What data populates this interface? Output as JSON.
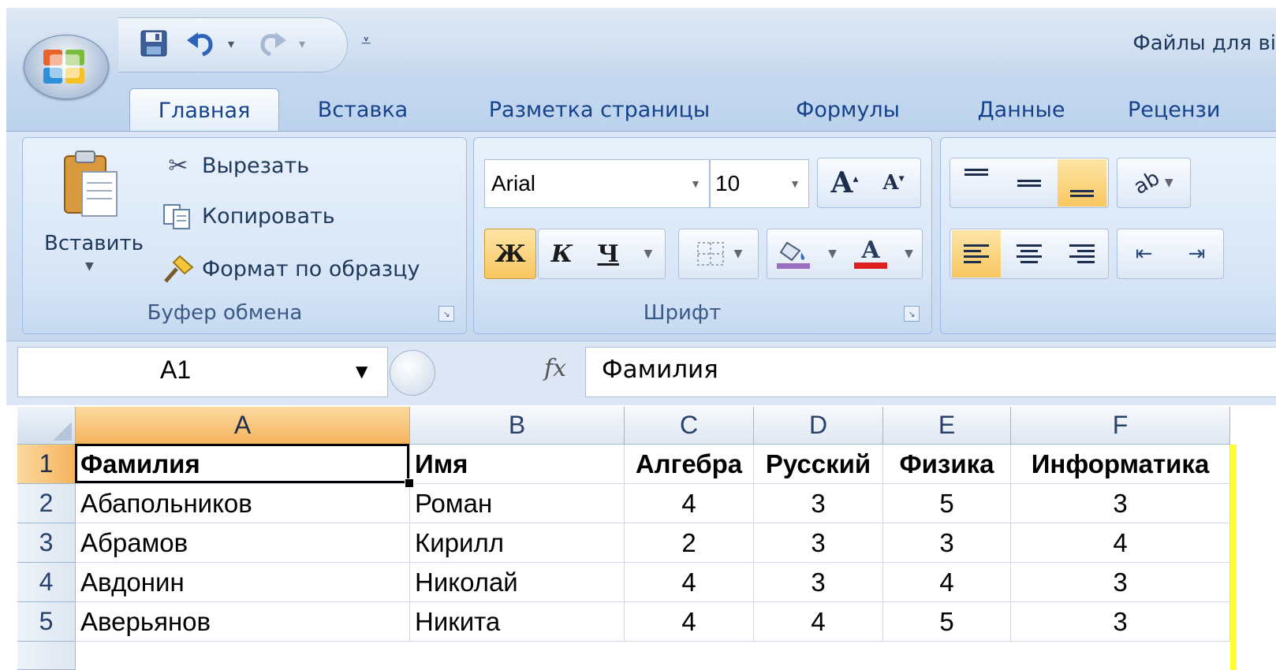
{
  "window": {
    "title": "Файлы для ві"
  },
  "quick_access": {
    "save_icon": "save-icon",
    "undo_icon": "undo-icon",
    "redo_icon": "redo-icon",
    "customize_icon": "customize-qat-icon"
  },
  "tabs": [
    {
      "label": "Главная",
      "active": true
    },
    {
      "label": "Вставка"
    },
    {
      "label": "Разметка страницы"
    },
    {
      "label": "Формулы"
    },
    {
      "label": "Данные"
    },
    {
      "label": "Рецензи"
    }
  ],
  "clipboard": {
    "paste_label": "Вставить",
    "cut_label": "Вырезать",
    "copy_label": "Копировать",
    "format_painter_label": "Формат по образцу",
    "group_label": "Буфер обмена"
  },
  "font": {
    "family": "Arial",
    "size": "10",
    "bold_label": "Ж",
    "italic_label": "К",
    "underline_label": "Ч",
    "grow_label": "A",
    "shrink_label": "A",
    "font_color_label": "A",
    "group_label": "Шрифт",
    "font_color": "#e02020",
    "fill_color": "#9a6fc2"
  },
  "formula_bar": {
    "name_box": "A1",
    "fx_label": "fx",
    "value": "Фамилия"
  },
  "sheet": {
    "columns": [
      "A",
      "B",
      "C",
      "D",
      "E",
      "F"
    ],
    "selected_column": "A",
    "rows": [
      {
        "num": "1",
        "cells": [
          "Фамилия",
          "Имя",
          "Алгебра",
          "Русский",
          "Физика",
          "Информатика"
        ]
      },
      {
        "num": "2",
        "cells": [
          "Абапольников",
          "Роман",
          "4",
          "3",
          "5",
          "3"
        ]
      },
      {
        "num": "3",
        "cells": [
          "Абрамов",
          "Кирилл",
          "2",
          "3",
          "3",
          "4"
        ]
      },
      {
        "num": "4",
        "cells": [
          "Авдонин",
          "Николай",
          "4",
          "3",
          "4",
          "3"
        ]
      },
      {
        "num": "5",
        "cells": [
          "Аверьянов",
          "Никита",
          "4",
          "4",
          "5",
          "3"
        ]
      }
    ]
  },
  "colors": {
    "accent_selection": "#f5b45c",
    "ribbon_text": "#15428b",
    "highlight_edge": "#ffff33"
  }
}
